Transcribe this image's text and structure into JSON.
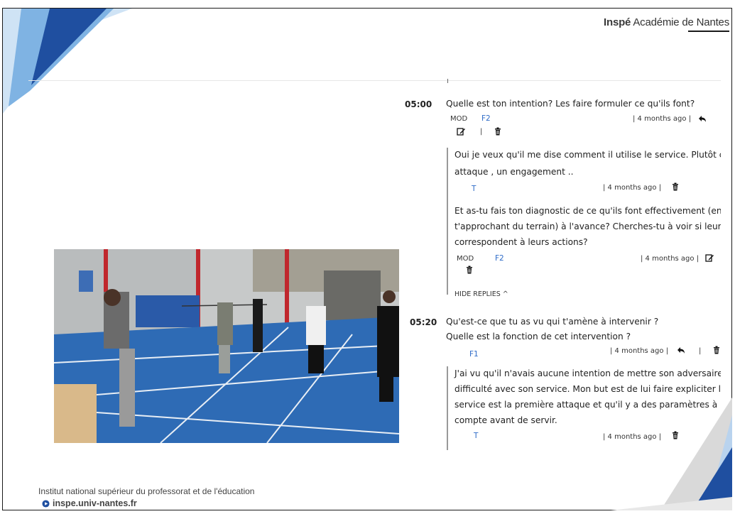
{
  "brand": {
    "strong": "Inspé",
    "rest": " Académie de Nantes"
  },
  "comments": [
    {
      "timestamp": "05:00",
      "text_lines": [
        "Quelle est ton intention? Les faire formuler ce qu'ils font?"
      ],
      "badge": "MOD",
      "author": "F2",
      "age": "| 4 months ago |",
      "sep": "|",
      "replies": [
        {
          "text_lines": [
            "Oui je veux qu'il me dise comment il utilise le service. Plutôt comme",
            "attaque , un engagement .."
          ],
          "author": "T",
          "age": "| 4 months ago |"
        },
        {
          "text_lines": [
            "Et as-tu fais ton diagnostic de ce qu'ils font effectivement (en",
            "t'approchant du terrain) à l'avance? Cherches-tu à voir si leurs inten",
            "correspondent à leurs actions?"
          ],
          "badge": "MOD",
          "author": "F2",
          "age": "| 4 months ago |"
        }
      ],
      "hide_replies": "HIDE REPLIES ^"
    },
    {
      "timestamp": "05:20",
      "text_lines": [
        "Qu'est-ce que tu as vu qui t'amène à intervenir ?",
        "Quelle est la fonction de cet intervention ?"
      ],
      "author": "F1",
      "age": "| 4 months ago |",
      "sep": "|",
      "replies": [
        {
          "text_lines": [
            "J'ai vu qu'il n'avais aucune intention de mettre son adversaire en",
            "difficulté avec son service. Mon but est de lui faire expliciter le fait q",
            "service est la première attaque et qu'il y a des paramètres à prendr",
            "compte avant de servir."
          ],
          "author": "T",
          "age": "| 4 months ago |"
        }
      ]
    }
  ],
  "footer": {
    "institute": "Institut national supérieur du professorat et de l'éducation",
    "link": "inspe.univ-nantes.fr"
  },
  "icons": {
    "reply": "reply-arrow-icon",
    "edit": "edit-icon",
    "delete": "trash-icon",
    "link": "play-circle-icon"
  },
  "colors": {
    "author_blue": "#2f6cc8",
    "accent_blue": "#1f4fa0",
    "court_blue": "#2e6bb5"
  }
}
